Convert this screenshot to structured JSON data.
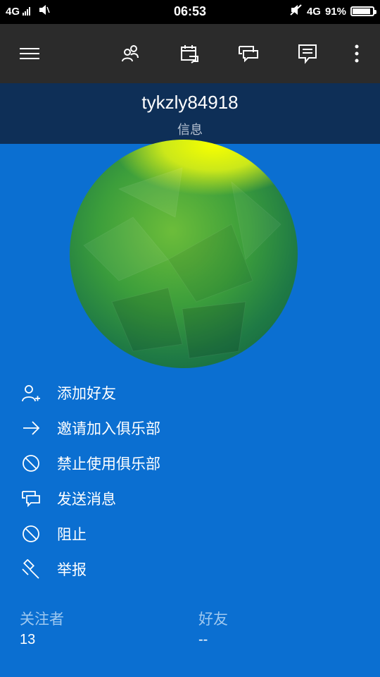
{
  "status_bar": {
    "network_left": "4G",
    "time": "06:53",
    "network_right": "4G",
    "battery": "91%",
    "battery_level": 0.91
  },
  "toolbar": {
    "icons": [
      "menu-icon",
      "people-icon",
      "calendar-icon",
      "chat-icon",
      "message-icon",
      "more-icon"
    ]
  },
  "header": {
    "title": "tykzly84918",
    "subtitle": "信息"
  },
  "menu": {
    "items": [
      {
        "label": "添加好友",
        "icon": "add-friend-icon"
      },
      {
        "label": "邀请加入俱乐部",
        "icon": "arrow-right-icon"
      },
      {
        "label": "禁止使用俱乐部",
        "icon": "ban-icon"
      },
      {
        "label": "发送消息",
        "icon": "chat-icon"
      },
      {
        "label": "阻止",
        "icon": "block-icon"
      },
      {
        "label": "举报",
        "icon": "gavel-icon"
      }
    ]
  },
  "stats": {
    "followers_label": "关注者",
    "followers_value": "13",
    "friends_label": "好友",
    "friends_value": "--"
  },
  "colors": {
    "background": "#0b6fd1",
    "toolbar": "#2b2b2b",
    "header": "#0e2f57",
    "stat_label": "#9ec8f0"
  }
}
